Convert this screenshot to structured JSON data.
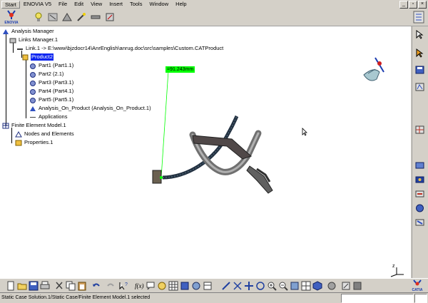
{
  "menubar": {
    "items": [
      "Start",
      "ENOVIA V5",
      "File",
      "Edit",
      "View",
      "Insert",
      "Tools",
      "Window",
      "Help"
    ]
  },
  "tree": {
    "nodes": [
      {
        "label": "Analysis Manager"
      },
      {
        "label": "Links Manager.1"
      },
      {
        "label": "Link.1 -> E:\\www\\bjzdocr14\\AnrEnglish\\anrug.doc\\src\\samples\\Custom.CATProduct"
      },
      {
        "label": "Product2",
        "selected": true
      },
      {
        "label": "Part1 (Part1.1)"
      },
      {
        "label": "Part2 (2.1)"
      },
      {
        "label": "Part3 (Part3.1)"
      },
      {
        "label": "Part4 (Part4.1)"
      },
      {
        "label": "Part5 (Part5.1)"
      },
      {
        "label": "Analysis_On_Product (Analysis_On_Product.1)"
      },
      {
        "label": "Applications"
      },
      {
        "label": "Finite Element Model.1"
      },
      {
        "label": "Nodes and Elements"
      },
      {
        "label": "Properties.1"
      }
    ]
  },
  "viewport": {
    "measure_label": "=91.243mm",
    "axis_label": "z"
  },
  "logos": {
    "enovia": "ENOVIA",
    "catia": "CATIA"
  },
  "status": {
    "message": "Static Case Solution.1/Static Case/Finite Element Model.1 selected"
  },
  "colors": {
    "selection": "#0a24f0",
    "measure": "#00ff00",
    "background": "#d4d0c8"
  }
}
